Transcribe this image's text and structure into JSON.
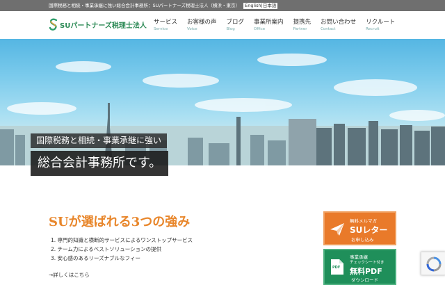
{
  "topbar": {
    "text": "国際税務と相続・事業承継に強い総合会計事務所：SUパートナーズ税理士法人（横浜・東京）",
    "lang_label": "English",
    "lang_current": "日本語"
  },
  "header": {
    "logo_text": "SUパートナーズ税理士法人"
  },
  "nav": {
    "items": [
      {
        "jp": "サービス",
        "en": "Service"
      },
      {
        "jp": "お客様の声",
        "en": "Voice"
      },
      {
        "jp": "ブログ",
        "en": "Blog"
      },
      {
        "jp": "事業所案内",
        "en": "Office"
      },
      {
        "jp": "提携先",
        "en": "Partner"
      },
      {
        "jp": "お問い合わせ",
        "en": "Contact"
      },
      {
        "jp": "リクルート",
        "en": "Recruit"
      }
    ]
  },
  "hero": {
    "caption_line1": "国際税務と相続・事業承継に強い",
    "caption_line2": "総合会計事務所です。"
  },
  "strengths": {
    "title": "SUが選ばれる3つの強み",
    "items": [
      "1. 専門的知識と横断的サービスによるワンストップサービス",
      "2. チーム力によるベストソリューションの提供",
      "3. 安心感のあるリーズナブルなフィー"
    ],
    "link": "→詳しくはこちら"
  },
  "banners": {
    "newsletter": {
      "small": "無料メルマガ",
      "big": "SUレター",
      "sub": "お申し込み"
    },
    "pdf": {
      "small": "事業承継",
      "small2": "チェックシート付き",
      "big": "無料PDF",
      "sub": "ダウンロード",
      "icon_label": "PDF"
    }
  },
  "colors": {
    "accent_orange": "#e8862b",
    "brand_green": "#2e8b57",
    "banner_orange": "#e97a2a",
    "banner_green": "#1f8f5a"
  }
}
